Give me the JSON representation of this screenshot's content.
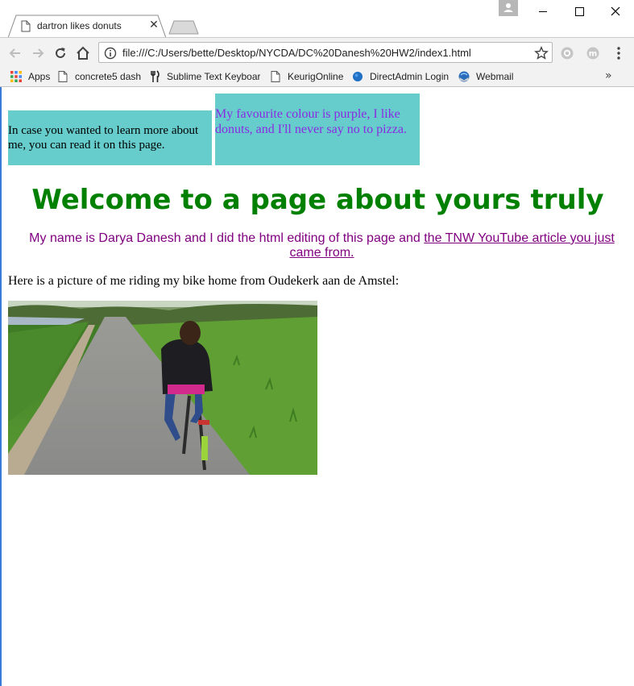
{
  "browser": {
    "tab_title": "dartron likes donuts",
    "url": "file:///C:/Users/bette/Desktop/NYCDA/DC%20Danesh%20HW2/index1.html",
    "bookmarks": [
      {
        "label": "Apps",
        "icon": "apps-grid-icon"
      },
      {
        "label": "concrete5 dash",
        "icon": "page-icon"
      },
      {
        "label": "Sublime Text Keyboar",
        "icon": "fork-knife-icon"
      },
      {
        "label": "KeurigOnline",
        "icon": "page-icon"
      },
      {
        "label": "DirectAdmin Login",
        "icon": "blue-dot-icon"
      },
      {
        "label": "Webmail",
        "icon": "webmail-icon"
      }
    ],
    "overflow_label": "»"
  },
  "page": {
    "box1_text": "In case you wanted to learn more about me, you can read it on this page.",
    "box2_text": "My favourite colour is purple, I like donuts, and I'll never say no to pizza.",
    "heading": "Welcome to a page about yours truly",
    "intro_text": "My name is Darya Danesh and I did the html editing of this page and ",
    "intro_link": "the TNW YouTube article you just came from.",
    "caption": "Here is a picture of me riding my bike home from Oudekerk aan de Amstel:"
  },
  "colors": {
    "box_bg": "#66cccc",
    "heading": "#008000",
    "intro": "#800080",
    "box2_text": "#8a2be2"
  }
}
